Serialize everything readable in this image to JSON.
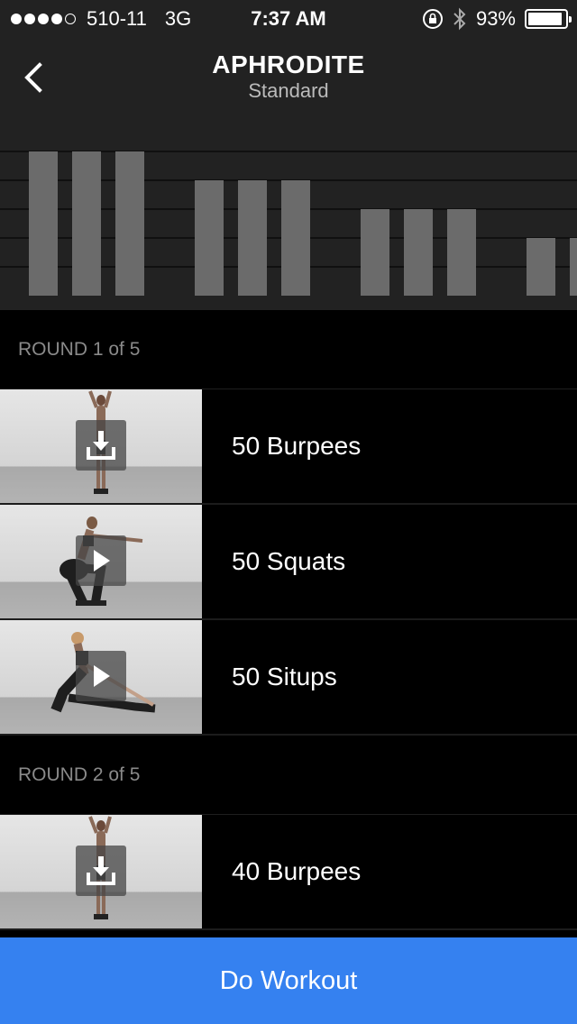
{
  "status_bar": {
    "carrier": "510-11",
    "network": "3G",
    "time": "7:37 AM",
    "battery": "93%",
    "battery_level": 0.93,
    "signal_bars": 4,
    "signal_total": 5
  },
  "header": {
    "title": "APHRODITE",
    "subtitle": "Standard"
  },
  "chart_data": {
    "type": "bar",
    "values": [
      5,
      5,
      5,
      4,
      4,
      4,
      3,
      3,
      3,
      2,
      2
    ],
    "ylim": [
      0,
      5
    ],
    "grid": true,
    "color": "#6b6b6b"
  },
  "rounds": [
    {
      "label": "ROUND 1 of 5",
      "exercises": [
        {
          "name": "50 Burpees",
          "action_icon": "download-icon",
          "pose": "standing"
        },
        {
          "name": "50 Squats",
          "action_icon": "play-icon",
          "pose": "squat"
        },
        {
          "name": "50 Situps",
          "action_icon": "play-icon",
          "pose": "situp"
        }
      ]
    },
    {
      "label": "ROUND 2 of 5",
      "exercises": [
        {
          "name": "40 Burpees",
          "action_icon": "download-icon",
          "pose": "standing"
        }
      ]
    }
  ],
  "footer": {
    "button_label": "Do Workout",
    "button_color": "#3581f0"
  }
}
